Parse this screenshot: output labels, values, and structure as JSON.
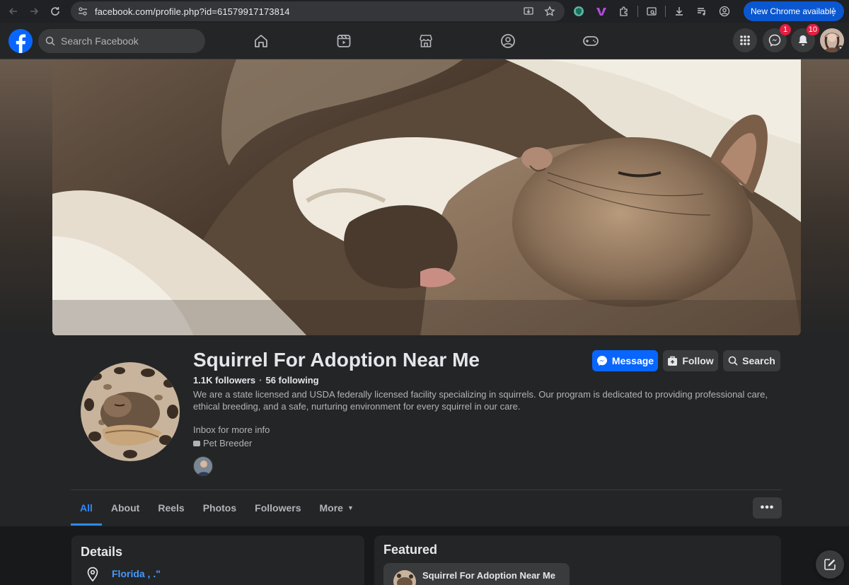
{
  "browser": {
    "url": "facebook.com/profile.php?id=61579917173814",
    "new_chrome_label": "New Chrome available"
  },
  "fb_nav": {
    "search_placeholder": "Search Facebook",
    "messenger_badge": "1",
    "notifications_badge": "10"
  },
  "profile": {
    "name": "Squirrel For Adoption Near Me",
    "followers": "1.1K followers",
    "following": "56 following",
    "bio": "We are a state licensed and USDA federally licensed facility specializing in squirrels. Our program is dedicated to providing professional care, ethical breeding, and a safe, nurturing environment for every squirrel in our care.",
    "inbox_note": "Inbox for more info",
    "category": "Pet Breeder",
    "buttons": {
      "message": "Message",
      "follow": "Follow",
      "search": "Search"
    }
  },
  "tabs": [
    {
      "label": "All",
      "active": true
    },
    {
      "label": "About"
    },
    {
      "label": "Reels"
    },
    {
      "label": "Photos"
    },
    {
      "label": "Followers"
    },
    {
      "label": "More"
    }
  ],
  "details": {
    "title": "Details",
    "location": "Florida , .\""
  },
  "featured": {
    "title": "Featured",
    "item_label": "Squirrel For Adoption Near Me"
  },
  "colors": {
    "accent": "#0866ff",
    "active_tab": "#2d88ff",
    "badge": "#e41e3f"
  }
}
